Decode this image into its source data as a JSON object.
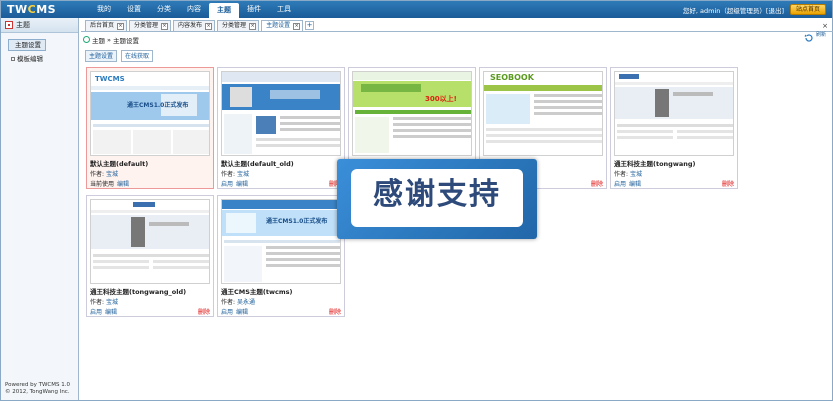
{
  "app": {
    "logo_left": "TW",
    "logo_accent": "C",
    "logo_right": "MS"
  },
  "nav": {
    "items": [
      "我的",
      "设置",
      "分类",
      "内容",
      "主题",
      "插件",
      "工具"
    ],
    "active_index": 4
  },
  "user": {
    "text": "您好, admin（超级管理员）[退出]",
    "site_button": "站点首页"
  },
  "sidebar": {
    "title": "主题",
    "items": [
      "主题设置",
      "模板编辑"
    ],
    "powered_line1": "Powered by TWCMS 1.0",
    "powered_line2": "© 2012, TongWang Inc."
  },
  "tabs": [
    {
      "label": "后台首页"
    },
    {
      "label": "分类管理"
    },
    {
      "label": "内容发布"
    },
    {
      "label": "分类管理"
    },
    {
      "label": "主题设置"
    }
  ],
  "breadcrumb": {
    "root": "主题",
    "sep": "»",
    "current": "主题设置",
    "refresh_label": "刷新"
  },
  "subtabs": [
    "主题设置",
    "在线获取"
  ],
  "themes": [
    {
      "name": "默认主题(default)",
      "author_label": "作者:",
      "author": "宝城",
      "status": "当前使用",
      "action2": "编辑",
      "delete": ""
    },
    {
      "name": "默认主题(default_old)",
      "author_label": "作者:",
      "author": "宝城",
      "status": "启用",
      "action2": "编辑",
      "delete": "删除"
    },
    {
      "name": "",
      "author_label": "",
      "author": "",
      "status": "",
      "action2": "",
      "delete": ""
    },
    {
      "name": "",
      "author_label": "",
      "author": "",
      "status": "",
      "action2": "",
      "delete": "删除"
    },
    {
      "name": "通王科技主题(tongwang)",
      "author_label": "作者:",
      "author": "宝城",
      "status": "启用",
      "action2": "编辑",
      "delete": "删除"
    },
    {
      "name": "通王科技主题(tongwang_old)",
      "author_label": "作者:",
      "author": "宝城",
      "status": "启用",
      "action2": "编辑",
      "delete": "删除"
    },
    {
      "name": "通王CMS主题(twcms)",
      "author_label": "作者:",
      "author": "吴永通",
      "status": "启用",
      "action2": "编辑",
      "delete": "删除"
    }
  ],
  "thumbs": {
    "t1_banner": "通王CMS1.0正式发布",
    "t2_banner": "",
    "t3_badge": "300以上!",
    "t4_brand": "SEOBOOK",
    "t7_banner": "通王CMS1.0正式发布"
  },
  "overlay": {
    "text": "感谢支持"
  },
  "colors": {
    "nav_blue": "#1a5c98",
    "accent_gold": "#ffd23a",
    "delete_red": "#dd0000",
    "overlay_blue": "#2166a8"
  }
}
